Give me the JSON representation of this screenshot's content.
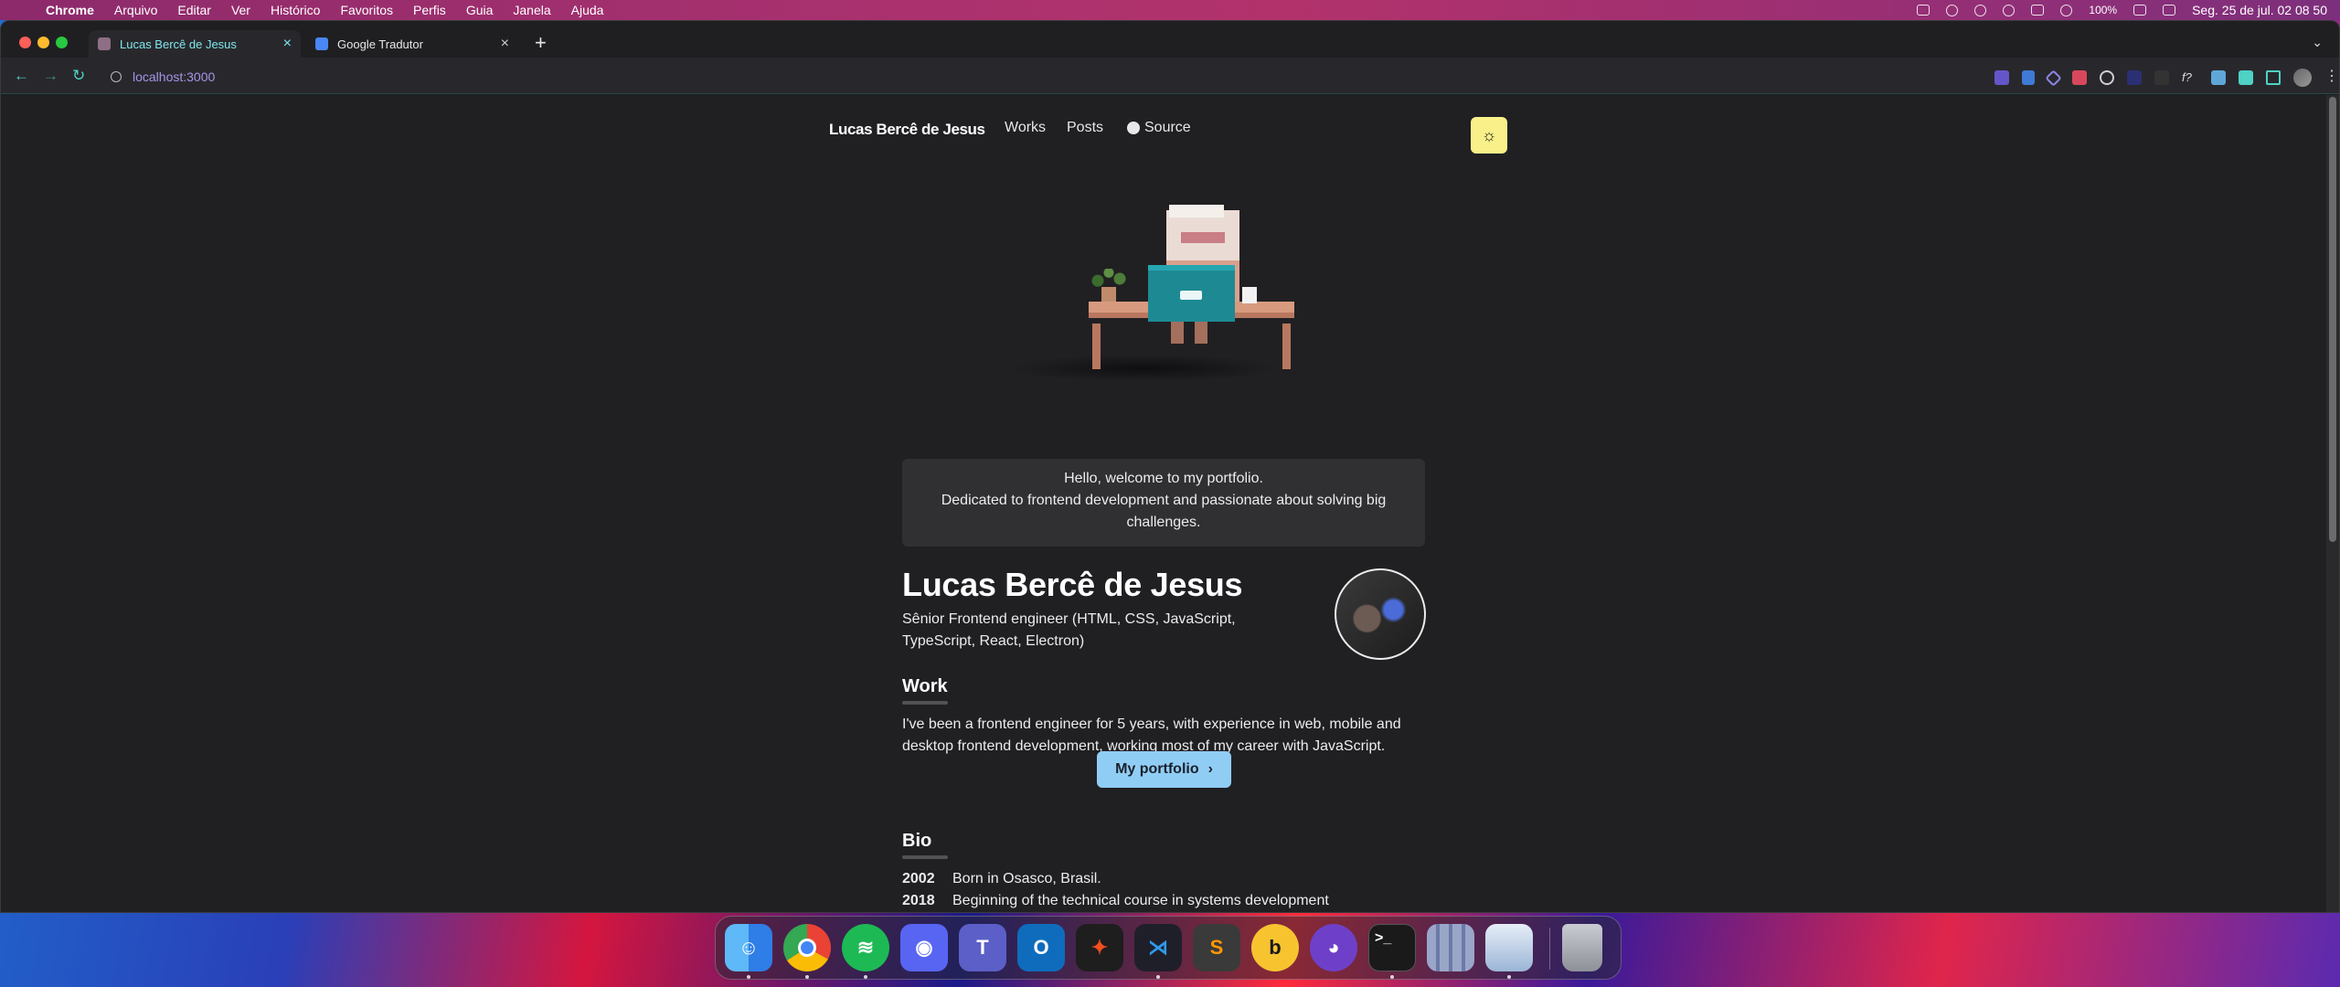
{
  "menubar": {
    "app": "Chrome",
    "items": [
      "Arquivo",
      "Editar",
      "Ver",
      "Histórico",
      "Favoritos",
      "Perfis",
      "Guia",
      "Janela",
      "Ajuda"
    ],
    "battery": "100%",
    "datetime": "Seg. 25 de jul.  02 08 50"
  },
  "browser": {
    "tabs": [
      {
        "title": "Lucas Bercê de Jesus",
        "active": true
      },
      {
        "title": "Google Tradutor",
        "active": false
      }
    ],
    "new_tab": "+",
    "url": "localhost:3000"
  },
  "site": {
    "logo": "Lucas Bercê de Jesus",
    "nav": {
      "works": "Works",
      "posts": "Posts",
      "source": "Source"
    },
    "theme_toggle_icon": "sun-icon",
    "intro_line1": "Hello, welcome to my portfolio.",
    "intro_line2": "Dedicated to frontend development and passionate about solving big challenges.",
    "name": "Lucas Bercê de Jesus",
    "role": "Sênior Frontend engineer (HTML, CSS, JavaScript, TypeScript, React, Electron)",
    "work_title": "Work",
    "work_text": "I've been a frontend engineer for 5 years, with experience in web, mobile and desktop frontend development, working most of my career with JavaScript.",
    "portfolio_button": "My portfolio",
    "portfolio_chevron": "›",
    "bio_title": "Bio",
    "bio": [
      {
        "year": "2002",
        "text": "Born in Osasco, Brasil."
      },
      {
        "year": "2018",
        "text": "Beginning of the technical course in systems development (Technological Institute of Barueri);"
      }
    ]
  },
  "dock": {
    "apps": [
      "Finder",
      "Chrome",
      "Spotify",
      "Discord",
      "Teams",
      "Outlook",
      "Figma",
      "VS Code",
      "Sublime Text",
      "Bitwarden",
      "GitHub Desktop",
      "Terminal",
      "Launchpad",
      "Preview",
      "Trash"
    ]
  },
  "colors": {
    "accent_teal": "#4fd1c5",
    "button_blue": "#90cdf4",
    "theme_yellow": "#faf089",
    "page_bg": "#202023"
  }
}
